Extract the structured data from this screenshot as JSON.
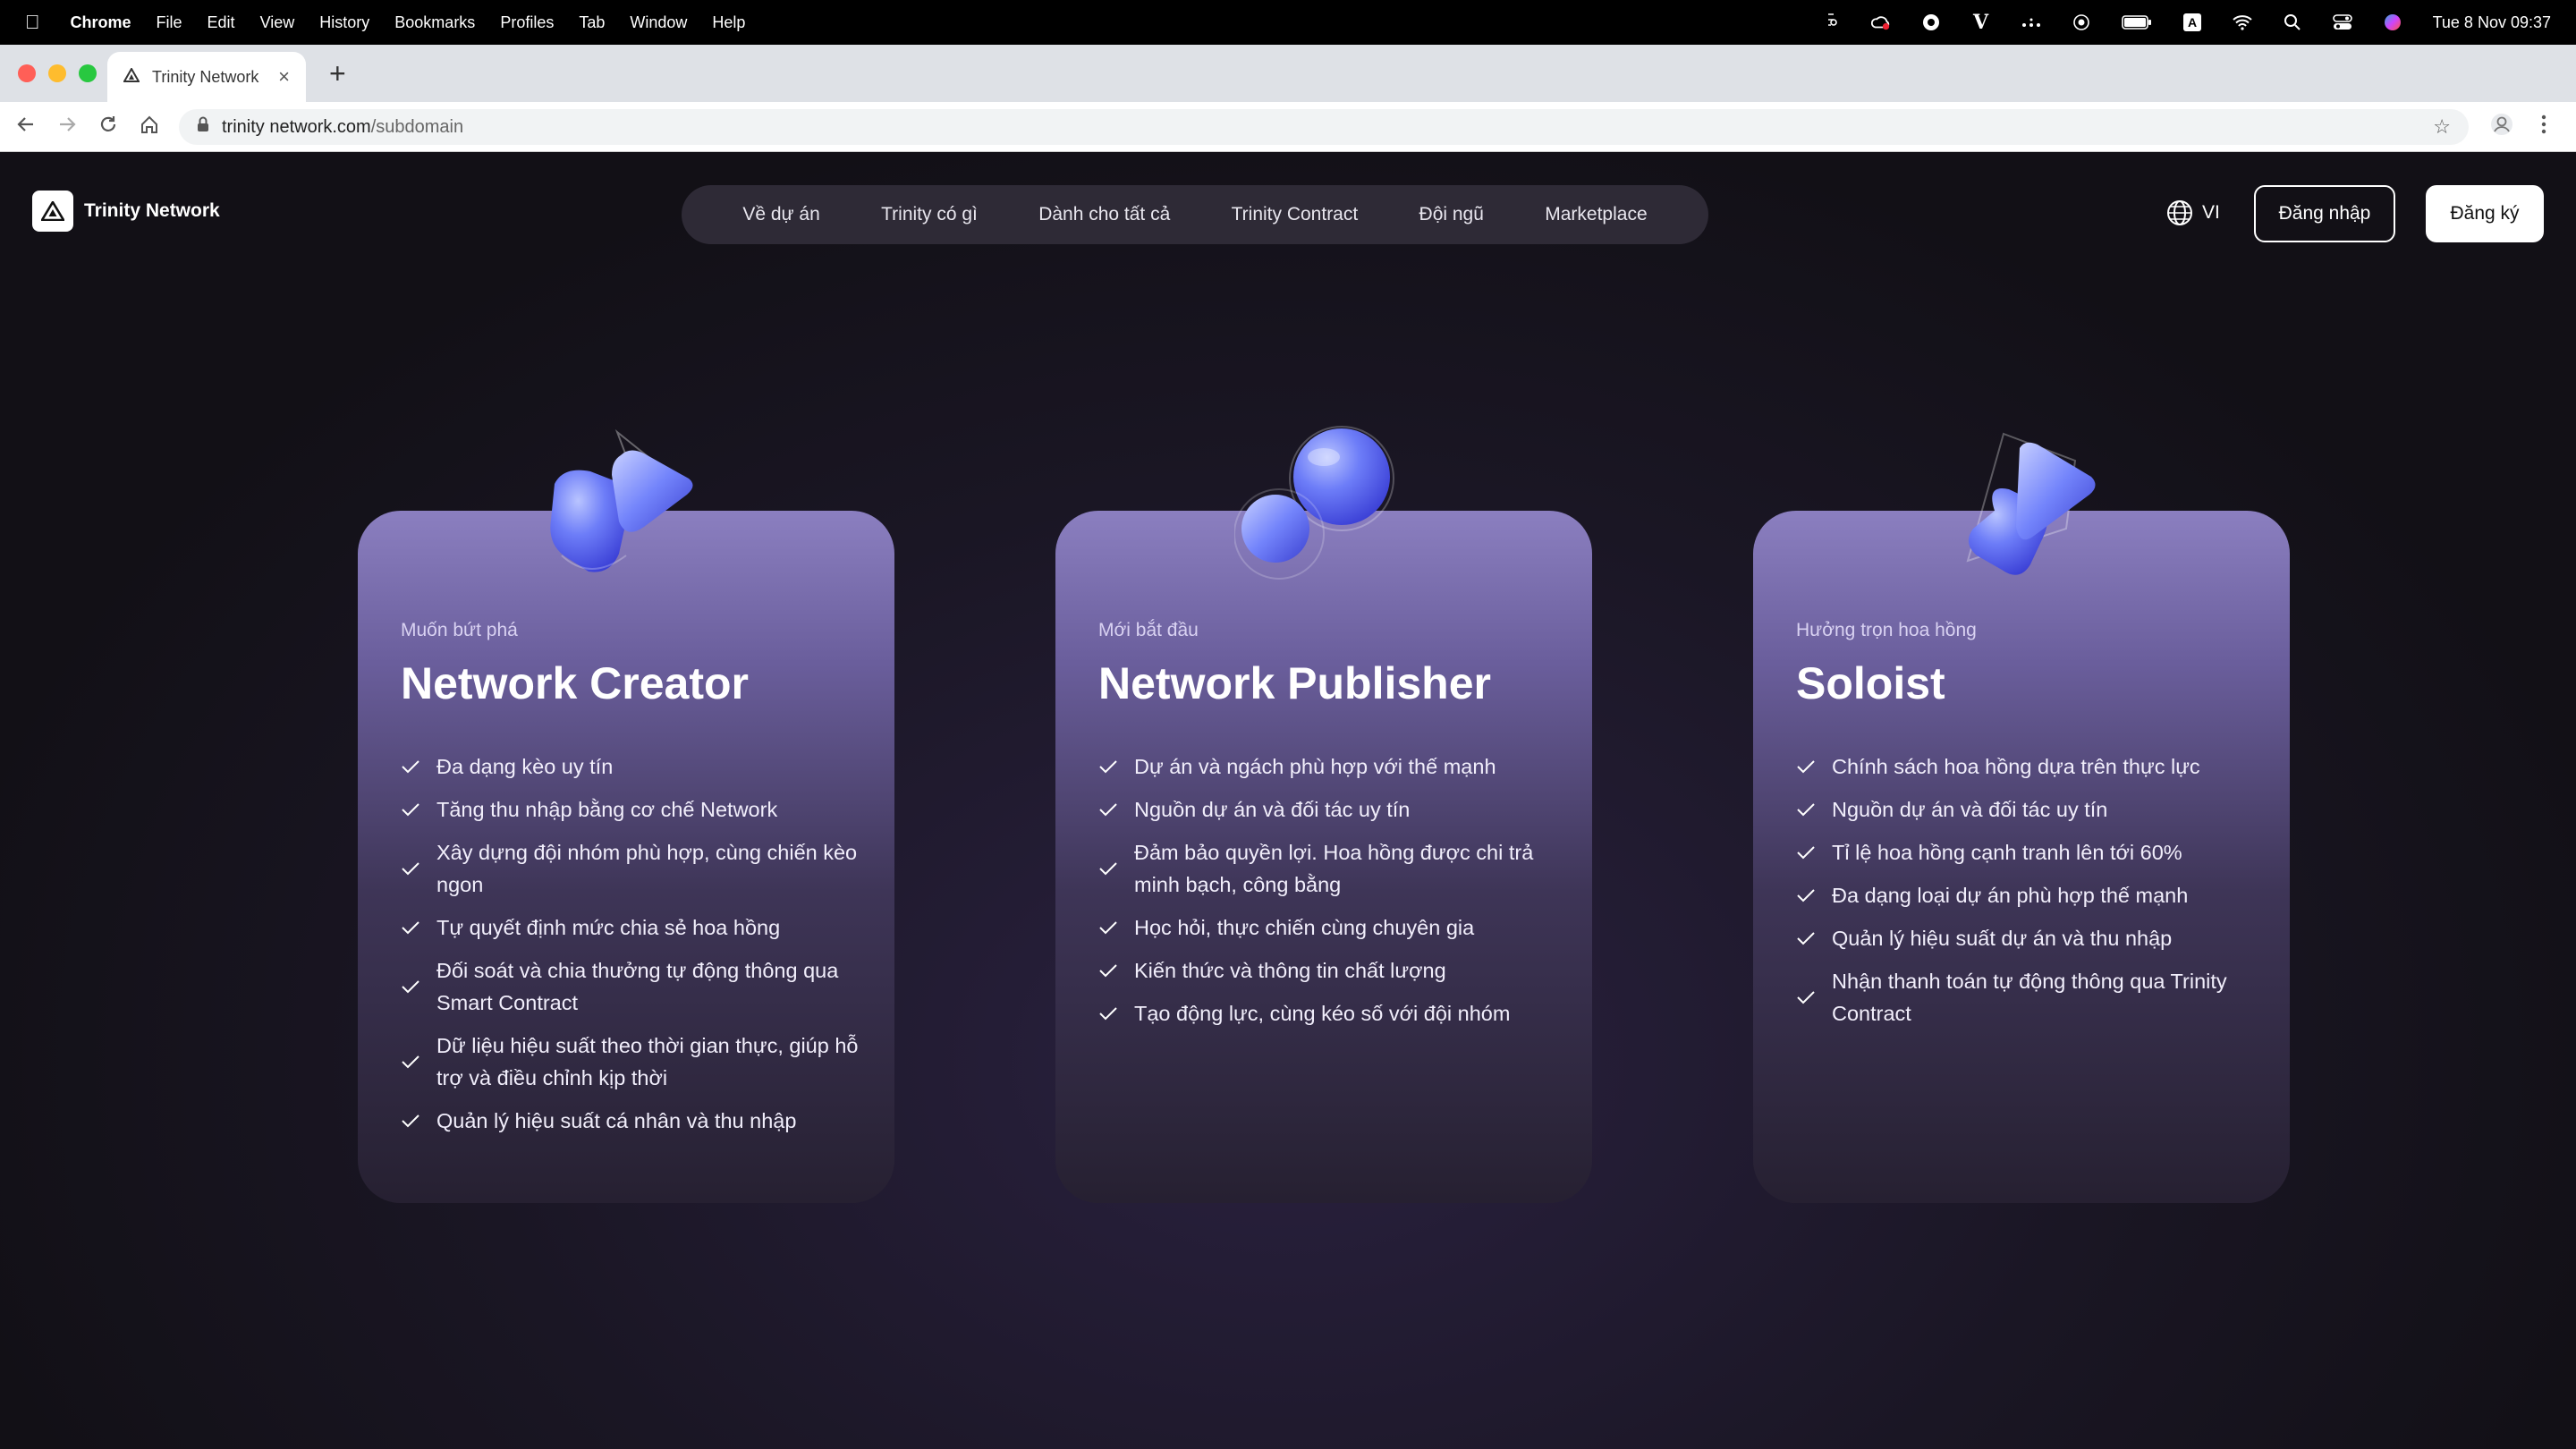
{
  "menubar": {
    "app": "Chrome",
    "items": [
      "File",
      "Edit",
      "View",
      "History",
      "Bookmarks",
      "Profiles",
      "Tab",
      "Window",
      "Help"
    ],
    "clock": "Tue 8 Nov  09:37"
  },
  "browser": {
    "tab_title": "Trinity Network",
    "url_host": "trinity network.com",
    "url_path": "/subdomain"
  },
  "site": {
    "brand": "Trinity Network",
    "nav": [
      "Về dự án",
      "Trinity có gì",
      "Dành cho tất cả",
      "Trinity Contract",
      "Đội ngũ",
      "Marketplace"
    ],
    "lang": "VI",
    "login": "Đăng nhập",
    "register": "Đăng ký"
  },
  "cards": [
    {
      "subtitle": "Muốn bứt phá",
      "title": "Network Creator",
      "icon": "glass-shapes-icon",
      "features": [
        "Đa dạng kèo uy tín",
        "Tăng thu nhập bằng cơ chế Network",
        "Xây dựng đội nhóm phù hợp, cùng chiến kèo ngon",
        "Tự quyết định mức chia sẻ hoa hồng",
        "Đối soát và chia thưởng tự động thông qua Smart Contract",
        "Dữ liệu hiệu suất theo thời gian thực, giúp hỗ trợ và điều chỉnh kịp thời",
        "Quản lý hiệu suất cá nhân và thu nhập"
      ]
    },
    {
      "subtitle": "Mới bắt đầu",
      "title": "Network Publisher",
      "icon": "glass-spheres-icon",
      "features": [
        "Dự án và ngách phù hợp với thế mạnh",
        "Nguồn dự án và đối tác uy tín",
        "Đảm bảo quyền lợi. Hoa hồng được chi trả minh bạch, công bằng",
        "Học hỏi, thực chiến cùng chuyên gia",
        "Kiến thức và thông tin chất lượng",
        "Tạo động lực, cùng kéo số với đội nhóm"
      ]
    },
    {
      "subtitle": "Hưởng trọn hoa hồng",
      "title": "Soloist",
      "icon": "glass-triangle-icon",
      "features": [
        "Chính sách hoa hồng dựa trên thực lực",
        "Nguồn dự án và đối tác uy tín",
        "Tỉ lệ hoa hồng cạnh tranh lên tới 60%",
        "Đa dạng loại dự án phù hợp thế mạnh",
        "Quản lý hiệu suất dự án và thu nhập",
        "Nhận thanh toán tự động thông qua Trinity Contract"
      ]
    }
  ],
  "colors": {
    "accent_blue": "#5b6cf5",
    "card_top": "#8b7fc0",
    "card_bottom": "#262031",
    "nav_bg": "#2e2a36"
  }
}
